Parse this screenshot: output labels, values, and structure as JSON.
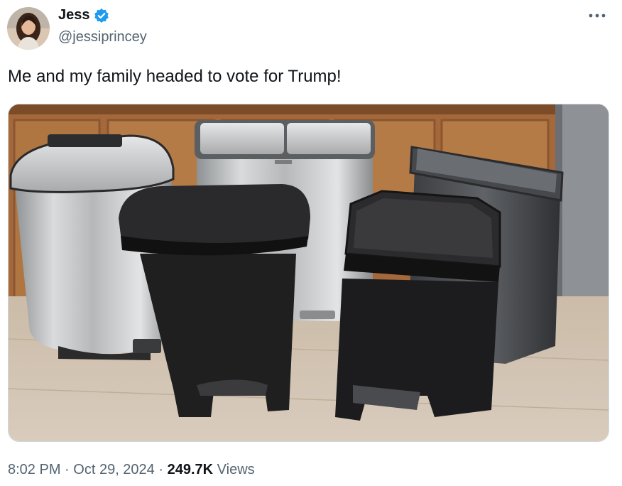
{
  "author": {
    "display_name": "Jess",
    "handle": "@jessiprincey",
    "verified": true,
    "badge_color": "#1d9bf0"
  },
  "tweet": {
    "text": "Me and my family headed to vote for Trump!"
  },
  "meta": {
    "time": "8:02 PM",
    "separator": "·",
    "date": "Oct 29, 2024",
    "views_count": "249.7K",
    "views_label": "Views"
  },
  "icons": {
    "more": "more-horizontal-icon",
    "verified": "verified-badge-icon"
  },
  "colors": {
    "text_primary": "#0f1419",
    "text_secondary": "#536471",
    "border": "#cfd9de"
  }
}
